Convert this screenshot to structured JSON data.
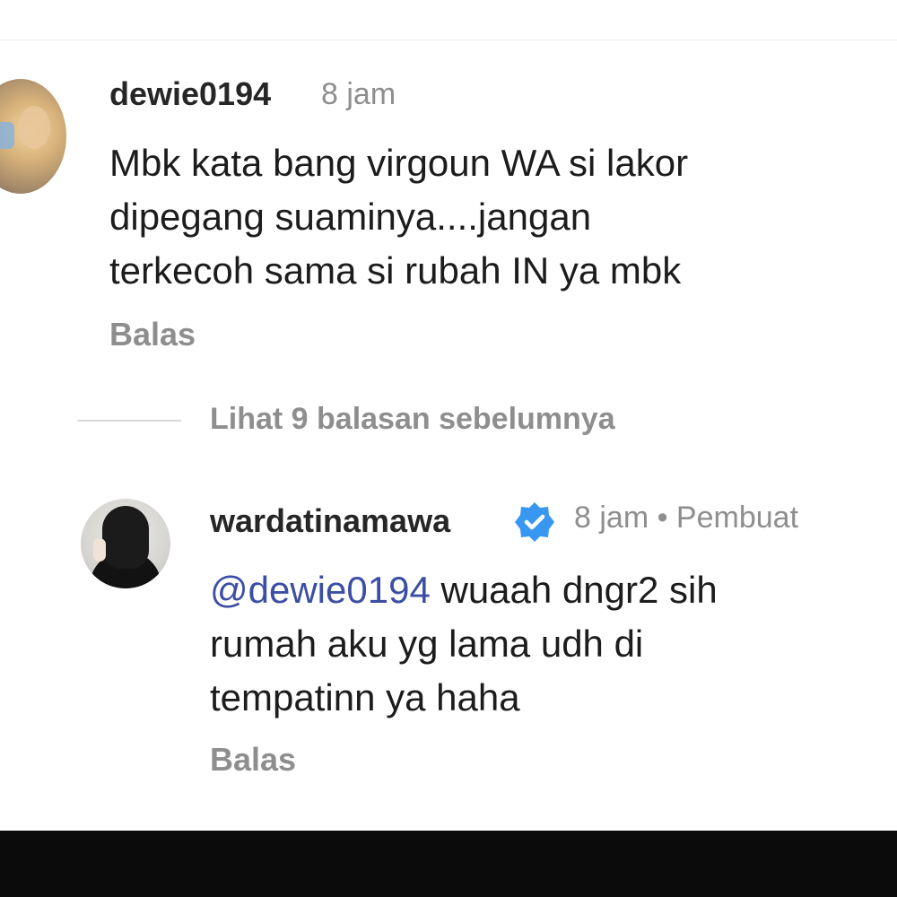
{
  "comments": [
    {
      "username": "dewie0194",
      "time": "8 jam",
      "text": "Mbk kata bang virgoun WA si lakor\ndipegang suaminya....jangan\nterkecoh sama si rubah  IN ya mbk",
      "reply_label": "Balas"
    }
  ],
  "view_replies": "Lihat 9 balasan sebelumnya",
  "replies": [
    {
      "username": "wardatinamawa",
      "verified": true,
      "time": "8 jam • Pembuat",
      "mention": "@dewie0194",
      "text": " wuaah dngr2 sih\nrumah aku yg lama udh di\ntempatinn  ya haha",
      "reply_label": "Balas"
    }
  ],
  "icons": {
    "verified": "verified-badge-icon"
  },
  "colors": {
    "verified_blue": "#3897f0",
    "mention": "#3b4ea3",
    "muted": "#8e8e8e",
    "bottom_bar": "#0b0b0c"
  }
}
